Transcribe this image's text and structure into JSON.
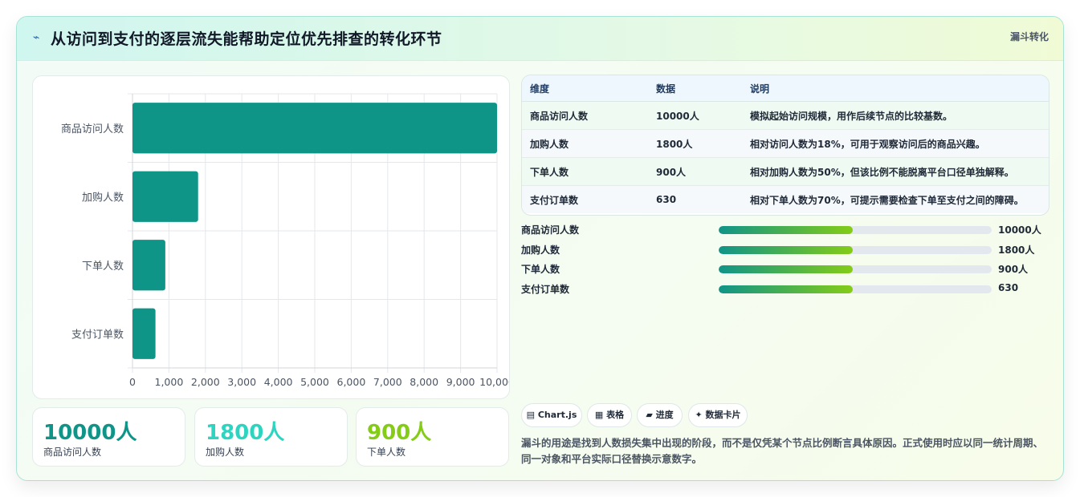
{
  "header": {
    "icon": "spark-icon",
    "title": "从访问到支付的逐层流失能帮助定位优先排查的转化环节",
    "tag": "漏斗转化"
  },
  "chart_data": {
    "type": "bar",
    "orientation": "horizontal",
    "categories": [
      "商品访问人数",
      "加购人数",
      "下单人数",
      "支付订单数"
    ],
    "values": [
      10000,
      1800,
      900,
      630
    ],
    "xlim": [
      0,
      10000
    ],
    "xticks": [
      "0",
      "1,000",
      "2,000",
      "3,000",
      "4,000",
      "5,000",
      "6,000",
      "7,000",
      "8,000",
      "9,000",
      "10,000"
    ],
    "grid": true,
    "color": "#0f9488"
  },
  "stats": [
    {
      "value": "10000人",
      "label": "商品访问人数",
      "color": "#0f9488"
    },
    {
      "value": "1800人",
      "label": "加购人数",
      "color": "#2dd4bf"
    },
    {
      "value": "900人",
      "label": "下单人数",
      "color": "#84cc16"
    }
  ],
  "table": {
    "headers": [
      "维度",
      "数据",
      "说明"
    ],
    "rows": [
      {
        "dim": "商品访问人数",
        "data": "10000人",
        "desc": "模拟起始访问规模，用作后续节点的比较基数。"
      },
      {
        "dim": "加购人数",
        "data": "1800人",
        "desc": "相对访问人数为18%，可用于观察访问后的商品兴趣。"
      },
      {
        "dim": "下单人数",
        "data": "900人",
        "desc": "相对加购人数为50%，但该比例不能脱离平台口径单独解释。"
      },
      {
        "dim": "支付订单数",
        "data": "630",
        "desc": "相对下单人数为70%，可提示需要检查下单至支付之间的障碍。"
      }
    ]
  },
  "progress": [
    {
      "label": "商品访问人数",
      "value": "10000人",
      "fraction": 0.49
    },
    {
      "label": "加购人数",
      "value": "1800人",
      "fraction": 0.49
    },
    {
      "label": "下单人数",
      "value": "900人",
      "fraction": 0.49
    },
    {
      "label": "支付订单数",
      "value": "630",
      "fraction": 0.49
    }
  ],
  "pills": [
    {
      "icon": "chart-icon",
      "glyph": "▤",
      "label": "Chart.js"
    },
    {
      "icon": "table-icon",
      "glyph": "▦",
      "label": "表格"
    },
    {
      "icon": "progress-icon",
      "glyph": "▰",
      "label": "进度"
    },
    {
      "icon": "sparkle-icon",
      "glyph": "✦",
      "label": "数据卡片"
    }
  ],
  "note": "漏斗的用途是找到人数损失集中出现的阶段，而不是仅凭某个节点比例断言具体原因。正式使用时应以同一统计周期、同一对象和平台实际口径替换示意数字。"
}
